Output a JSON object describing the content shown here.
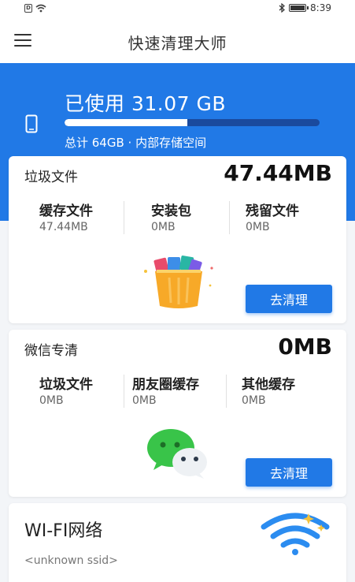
{
  "statusbar": {
    "time": "8:39",
    "sim_icon": "sim-icon",
    "wifi_icon": "wifi-signal-icon",
    "bluetooth_icon": "bluetooth-icon",
    "battery_icon": "battery-icon"
  },
  "appbar": {
    "title": "快速清理大师",
    "menu_icon": "menu-icon"
  },
  "storage": {
    "used_label": "已使用 31.07 GB",
    "used_fraction": 0.48,
    "subtitle": "总计 64GB · 内部存储空间",
    "icon": "phone-icon"
  },
  "trash": {
    "title": "垃圾文件",
    "total": "47.44MB",
    "items": [
      {
        "label": "缓存文件",
        "value": "47.44MB"
      },
      {
        "label": "安装包",
        "value": "0MB"
      },
      {
        "label": "残留文件",
        "value": "0MB"
      }
    ],
    "button": "去清理",
    "illustration": "trash-can-illustration"
  },
  "wechat": {
    "title": "微信专清",
    "total": "0MB",
    "items": [
      {
        "label": "垃圾文件",
        "value": "0MB"
      },
      {
        "label": "朋友圈缓存",
        "value": "0MB"
      },
      {
        "label": "其他缓存",
        "value": "0MB"
      }
    ],
    "button": "去清理",
    "illustration": "wechat-logo-illustration"
  },
  "wifi": {
    "title": "WI-FI网络",
    "ssid": "<unknown ssid>",
    "icon": "wifi-icon"
  },
  "colors": {
    "primary": "#2179e6",
    "background": "#f3f5f8"
  }
}
